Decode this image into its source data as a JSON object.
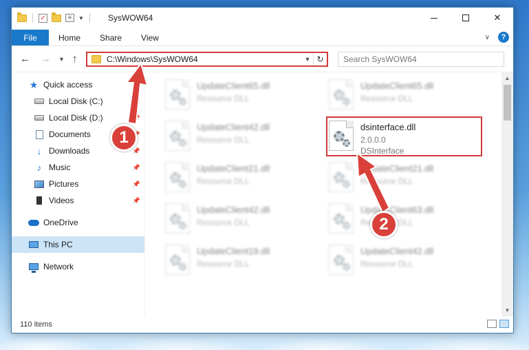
{
  "window": {
    "title": "SysWOW64",
    "controls": {
      "minimize": "—",
      "maximize": "☐",
      "close": "✕"
    }
  },
  "ribbon": {
    "tabs": [
      "File",
      "Home",
      "Share",
      "View"
    ],
    "help": "?"
  },
  "address": {
    "path": "C:\\Windows\\SysWOW64",
    "search_placeholder": "Search SysWOW64"
  },
  "sidebar": {
    "quick_access": "Quick access",
    "pinned": [
      {
        "label": "Local Disk (C:)",
        "icon": "local-disk-icon"
      },
      {
        "label": "Local Disk (D:)",
        "icon": "local-disk-icon"
      },
      {
        "label": "Documents",
        "icon": "documents-icon"
      },
      {
        "label": "Downloads",
        "icon": "downloads-icon"
      },
      {
        "label": "Music",
        "icon": "music-icon"
      },
      {
        "label": "Pictures",
        "icon": "pictures-icon"
      },
      {
        "label": "Videos",
        "icon": "videos-icon"
      }
    ],
    "onedrive": "OneDrive",
    "this_pc": "This PC",
    "network": "Network"
  },
  "files": {
    "left": [
      {
        "name": "UpdateClient65.dll",
        "desc": "Resource DLL"
      },
      {
        "name": "UpdateClient42.dll",
        "desc": "Resource DLL"
      },
      {
        "name": "UpdateClient21.dll",
        "desc": "Resource DLL"
      },
      {
        "name": "UpdateClient42.dll",
        "desc": "Resource DLL"
      },
      {
        "name": "UpdateClient19.dll",
        "desc": "Resource DLL"
      }
    ],
    "right": [
      {
        "name": "UpdateClient65.dll",
        "desc": "Resource DLL"
      },
      {
        "name": "dsinterface.dll",
        "version": "2.0.0.0",
        "desc": "DSInterface"
      },
      {
        "name": "UpdateClient21.dll",
        "desc": "Resource DLL"
      },
      {
        "name": "UpdateClient63.dll",
        "desc": "Resource DLL"
      },
      {
        "name": "UpdateClient42.dll",
        "desc": "Resource DLL"
      }
    ]
  },
  "status": {
    "item_count": "110 items"
  },
  "annotations": {
    "step1": "1",
    "step2": "2",
    "color": "#d9403a"
  }
}
